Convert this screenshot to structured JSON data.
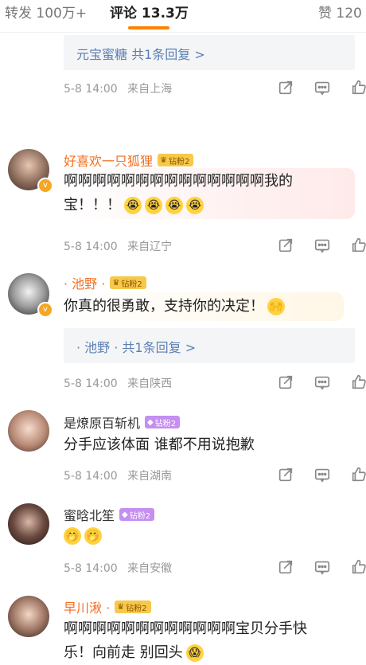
{
  "tabs": {
    "repost": "转发 100万+",
    "comments": "评论 13.3万",
    "likes": "赞 120"
  },
  "reply_summaries": [
    "元宝蜜糖  共1条回复 >",
    "· 池野 ·  共1条回复 >"
  ],
  "comments": [
    {
      "name": "好喜欢一只狐狸",
      "badge": "钻粉2",
      "lines": [
        "啊啊啊啊啊啊啊啊啊啊啊啊啊啊我的",
        "宝！！！"
      ],
      "date": "5-8 14:00",
      "location": "来自辽宁"
    },
    {
      "name": "· 池野 ·",
      "badge": "钻粉2",
      "lines": [
        "你真的很勇敢，支持你的决定！"
      ],
      "date": "5-8 14:00",
      "location": "来自陕西"
    },
    {
      "name": "是燎原百斩机",
      "badge": "钻粉2",
      "lines": [
        "分手应该体面 谁都不用说抱歉"
      ],
      "date": "5-8 14:00",
      "location": "来自湖南"
    },
    {
      "name": "蜜晗北笙",
      "badge": "钻粉2",
      "lines": [
        ""
      ],
      "date": "5-8 14:00",
      "location": "来自安徽"
    },
    {
      "name": "早川湫 ·",
      "badge": "钻粉2",
      "lines": [
        "啊啊啊啊啊啊啊啊啊啊啊啊宝贝分手快",
        "乐！向前走 别回头"
      ],
      "date": "",
      "location": ""
    }
  ],
  "top_meta": {
    "date": "5-8 14:00",
    "location": "来自上海"
  },
  "icons": [
    "share-icon",
    "comment-icon",
    "like-icon"
  ],
  "colors": {
    "accent": "#ff8200",
    "vip_name": "#f36f21",
    "link": "#5a7fb3"
  }
}
